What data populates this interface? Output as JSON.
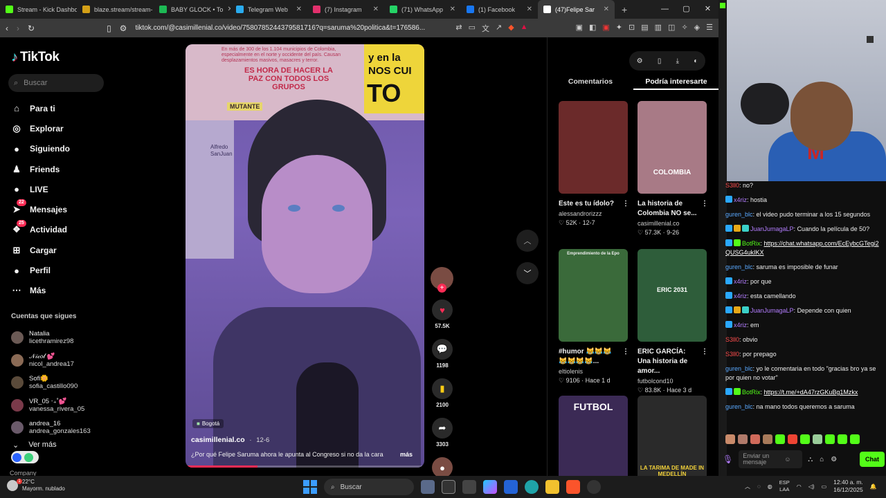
{
  "browser": {
    "tabs": [
      {
        "label": "Stream - Kick Dashbo",
        "color": "#53fc18"
      },
      {
        "label": "blaze.stream/stream-",
        "color": "#d4a017"
      },
      {
        "label": "BABY GLOCK • To",
        "color": "#1db954"
      },
      {
        "label": "Telegram Web",
        "color": "#2aabee"
      },
      {
        "label": "(7) Instagram",
        "color": "#e1306c"
      },
      {
        "label": "(71) WhatsApp",
        "color": "#25d366"
      },
      {
        "label": "(1) Facebook",
        "color": "#1877f2"
      },
      {
        "label": "(47)Felipe Sar",
        "color": "#ffffff"
      }
    ],
    "url": "tiktok.com/@casimillenial.co/video/7580785244379581716?q=saruma%20politica&t=176586..."
  },
  "tiktok": {
    "logo": "TikTok",
    "search_placeholder": "Buscar",
    "nav": [
      {
        "label": "Para ti",
        "icon": "home-icon",
        "glyph": "⌂"
      },
      {
        "label": "Explorar",
        "icon": "compass-icon",
        "glyph": "◎"
      },
      {
        "label": "Siguiendo",
        "icon": "following-avatar-icon",
        "glyph": "●"
      },
      {
        "label": "Friends",
        "icon": "friends-icon",
        "glyph": "♟"
      },
      {
        "label": "LIVE",
        "icon": "live-icon",
        "glyph": "●"
      },
      {
        "label": "Mensajes",
        "icon": "messages-icon",
        "glyph": "➤",
        "badge": "22"
      },
      {
        "label": "Actividad",
        "icon": "activity-icon",
        "glyph": "❖",
        "badge": "25"
      },
      {
        "label": "Cargar",
        "icon": "upload-icon",
        "glyph": "⊞"
      },
      {
        "label": "Perfil",
        "icon": "profile-icon",
        "glyph": "●"
      },
      {
        "label": "Más",
        "icon": "more-icon",
        "glyph": "⋯"
      }
    ],
    "following_title": "Cuentas que sigues",
    "following": [
      {
        "name": "Natalia",
        "user": "licethramirez98"
      },
      {
        "name": "𝒩𝒾𝒸𝑜𝓁 💕",
        "user": "nicol_andrea17"
      },
      {
        "name": "Sofi🌼",
        "user": "sofia_castillo090"
      },
      {
        "name": "VR_05 ‧₊˚💕",
        "user": "vanessa_rivera_05"
      },
      {
        "name": "andrea_16",
        "user": "andrea_gonzales163"
      }
    ],
    "see_more": "Ver más",
    "company": "Company",
    "video": {
      "poster_text_1": "En más de 300 de los 1.104 municipios de Colombia, especialmente en el norte y occidente del país. Causan desplazamientos masivos, masacres y terror.",
      "poster_text_2": "ES HORA DE HACER LA PAZ CON TODOS LOS GRUPOS",
      "poster_text_3": "MUTANTE",
      "poster_right_1": "y en la NOS CUI",
      "poster_right_2": "TO",
      "poster_left": "Alfredo SanJuan",
      "location": "Bogotá",
      "author": "casimillenial.co",
      "date": "12-6",
      "description": "¿Por qué Felipe Saruma ahora le apunta al Congreso si no da la cara",
      "more": "más",
      "progress": 0.3
    },
    "actions": {
      "likes": "57.5K",
      "comments": "1198",
      "saves": "2100",
      "shares": "3303"
    },
    "right_tabs": [
      "Comentarios",
      "Podría interesarte"
    ],
    "recommended": [
      {
        "title": "Este es tu ídolo?",
        "user": "alessandrorizzz",
        "likes": "52K",
        "date": "12-7",
        "bg": "#6b2a2a",
        "overlay": ""
      },
      {
        "title": "La historia de Colombia NO se...",
        "user": "casimillenial.co",
        "likes": "57.3K",
        "date": "9-26",
        "bg": "#a87a86",
        "overlay": "COLOMBIA"
      },
      {
        "title": "#humor 😹😹😹 😹😹😹😹...",
        "user": "eltiolenis",
        "likes": "9106",
        "date": "Hace 1 d",
        "bg": "#3a6a3a",
        "overlay": "Emprendimiento de la Epo"
      },
      {
        "title": "ERIC GARCÍA: Una historia de amor...",
        "user": "futbolcond10",
        "likes": "83.8K",
        "date": "Hace 3 d",
        "bg": "#2e5d3a",
        "overlay": "ERIC 2031"
      },
      {
        "title": "",
        "user": "",
        "likes": "",
        "date": "",
        "bg": "#3b2a55",
        "overlay": "FUTBOL"
      },
      {
        "title": "",
        "user": "",
        "likes": "",
        "date": "",
        "bg": "#2a2a2a",
        "overlay": "LA TARIMA DE MADE IN MEDELLÍN"
      }
    ]
  },
  "stream": {
    "chat": [
      {
        "user": "S3ll0",
        "text": "no?",
        "color": "#ff4d4d"
      },
      {
        "user": "x4riz",
        "text": "hostia",
        "color": "#b37dff",
        "badges": [
          "#2aa8ff"
        ]
      },
      {
        "user": "guren_blc",
        "text": "el video pudo terminar a los 15 segundos",
        "color": "#5aa9ff"
      },
      {
        "user": "JuanJumagaLP",
        "text": "Cuando la película de 50?",
        "color": "#b37dff",
        "badges": [
          "#2aa8ff",
          "#e6a817",
          "#3ad0c8"
        ]
      },
      {
        "user": "BotRix",
        "text": "",
        "link": "https://chat.whatsapp.com/EcEybcGTegi2QUSG4ukIKX",
        "color": "#53fc18",
        "badges": [
          "#2aa8ff",
          "#53fc18"
        ]
      },
      {
        "user": "guren_blc",
        "text": "saruma es imposible de funar",
        "color": "#5aa9ff"
      },
      {
        "user": "x4riz",
        "text": "por que",
        "color": "#b37dff",
        "badges": [
          "#2aa8ff"
        ]
      },
      {
        "user": "x4riz",
        "text": "esta camellando",
        "color": "#b37dff",
        "badges": [
          "#2aa8ff"
        ]
      },
      {
        "user": "JuanJumagaLP",
        "text": "Depende con quien",
        "color": "#b37dff",
        "badges": [
          "#2aa8ff",
          "#e6a817",
          "#3ad0c8"
        ]
      },
      {
        "user": "x4riz",
        "text": "em",
        "color": "#b37dff",
        "badges": [
          "#2aa8ff"
        ]
      },
      {
        "user": "S3ll0",
        "text": "obvio",
        "color": "#ff4d4d"
      },
      {
        "user": "S3ll0",
        "text": "por prepago",
        "color": "#ff4d4d"
      },
      {
        "user": "guren_blc",
        "text": "yo le comentaria en todo \"gracias bro ya se por quien no votar\"",
        "color": "#5aa9ff"
      },
      {
        "user": "BotRix",
        "text": "",
        "link": "https://t.me/+dA47rzGKuBg1Mzkx",
        "color": "#53fc18",
        "badges": [
          "#2aa8ff",
          "#53fc18"
        ]
      },
      {
        "user": "guren_blc",
        "text": "na mano todos queremos a saruma",
        "color": "#5aa9ff"
      }
    ],
    "chat_placeholder": "Enviar un mensaje",
    "chat_button": "Chat"
  },
  "taskbar": {
    "weather_temp": "22°C",
    "weather_desc": "Mayorm. nublado",
    "weather_badge": "1",
    "search": "Buscar",
    "lang1": "ESP",
    "lang2": "LAA",
    "time": "12:40 a. m.",
    "date": "16/12/2025"
  },
  "colors": {
    "tiktok_red": "#fe2c55",
    "kick_green": "#53fc18"
  }
}
